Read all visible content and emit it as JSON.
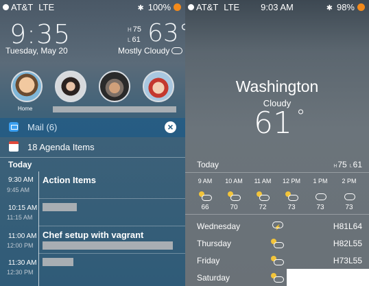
{
  "left": {
    "status": {
      "carrier": "AT&T",
      "network": "LTE",
      "battery": "100%",
      "bluetooth": "✱"
    },
    "widget": {
      "time": "9:35",
      "date": "Tuesday, May 20",
      "high_label": "H",
      "high": "75",
      "low_label": "L",
      "low": "61",
      "temp": "63°",
      "condition": "Mostly Cloudy"
    },
    "contacts": {
      "first_label": "Home"
    },
    "mail": {
      "label": "Mail (6)",
      "clear_glyph": "×"
    },
    "agenda": {
      "label": "18 Agenda Items",
      "section": "Today"
    },
    "events": [
      {
        "start": "9:30 AM",
        "end": "9:45 AM",
        "title": "Action Items"
      },
      {
        "start": "10:15 AM",
        "end": "11:15 AM",
        "title": ""
      },
      {
        "start": "11:00 AM",
        "end": "12:00 PM",
        "title": "Chef setup with vagrant"
      },
      {
        "start": "11:30 AM",
        "end": "12:30 PM",
        "title": ""
      }
    ]
  },
  "right": {
    "status": {
      "carrier": "AT&T",
      "network": "LTE",
      "time": "9:03 AM",
      "battery": "98%",
      "bluetooth": "✱"
    },
    "city": "Washington",
    "condition": "Cloudy",
    "temp": "61",
    "degree": "°",
    "today": {
      "label": "Today",
      "high_label": "H",
      "high": "75",
      "low_label": "L",
      "low": "61"
    },
    "hourly": [
      {
        "time": "9 AM",
        "icon": "partly-sunny-icon",
        "temp": "66"
      },
      {
        "time": "10 AM",
        "icon": "partly-sunny-icon",
        "temp": "70"
      },
      {
        "time": "11 AM",
        "icon": "partly-sunny-icon",
        "temp": "72"
      },
      {
        "time": "12 PM",
        "icon": "partly-sunny-icon",
        "temp": "73"
      },
      {
        "time": "1 PM",
        "icon": "cloud-icon",
        "temp": "73"
      },
      {
        "time": "2 PM",
        "icon": "cloud-icon",
        "temp": "73"
      }
    ],
    "daily": [
      {
        "day": "Wednesday",
        "icon": "thunderstorm-icon",
        "high_label": "H",
        "high": "81",
        "low_label": "L",
        "low": "64"
      },
      {
        "day": "Thursday",
        "icon": "partly-sunny-icon",
        "high_label": "H",
        "high": "82",
        "low_label": "L",
        "low": "55"
      },
      {
        "day": "Friday",
        "icon": "partly-sunny-icon",
        "high_label": "H",
        "high": "73",
        "low_label": "L",
        "low": "55"
      },
      {
        "day": "Saturday",
        "icon": "partly-sunny-icon",
        "high_label": "",
        "high": "",
        "low_label": "",
        "low": ""
      }
    ]
  },
  "colors": {
    "battery": "#f28a1c",
    "mail_row": "#1f5a86",
    "calendar_red": "#e0483a"
  }
}
